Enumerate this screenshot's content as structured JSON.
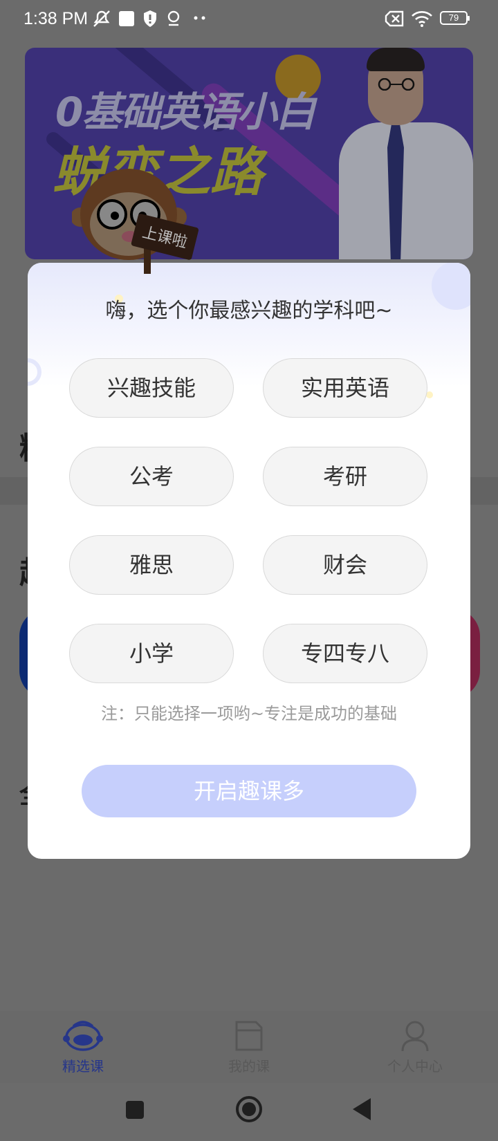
{
  "status_bar": {
    "time": "1:38 PM",
    "battery_level": "79",
    "icons": [
      "mute-icon",
      "notification-square-icon",
      "shield-icon",
      "location-icon",
      "more-dots-icon",
      "sim-off-icon",
      "wifi-icon",
      "battery-icon"
    ]
  },
  "banner": {
    "title_line1": "0基础英语小白",
    "title_line2": "蜕变之路",
    "mascot_sign": "上课啦"
  },
  "modal": {
    "title": "嗨，选个你最感兴趣的学科吧~",
    "options": [
      {
        "label": "兴趣技能"
      },
      {
        "label": "实用英语"
      },
      {
        "label": "公考"
      },
      {
        "label": "考研"
      },
      {
        "label": "雅思"
      },
      {
        "label": "财会"
      },
      {
        "label": "小学"
      },
      {
        "label": "专四专八"
      }
    ],
    "note": "注：只能选择一项哟~专注是成功的基础",
    "start_button": "开启趣课多",
    "start_button_color": "#c6cffc"
  },
  "bottom_nav": {
    "items": [
      {
        "label": "精选课",
        "icon": "monkey-course-icon",
        "active": true
      },
      {
        "label": "我的课",
        "icon": "folder-icon",
        "active": false
      },
      {
        "label": "个人中心",
        "icon": "user-icon",
        "active": false
      }
    ],
    "active_color": "#26368a"
  },
  "system_nav": {
    "buttons": [
      "recent-apps-icon",
      "home-icon",
      "back-icon"
    ]
  }
}
